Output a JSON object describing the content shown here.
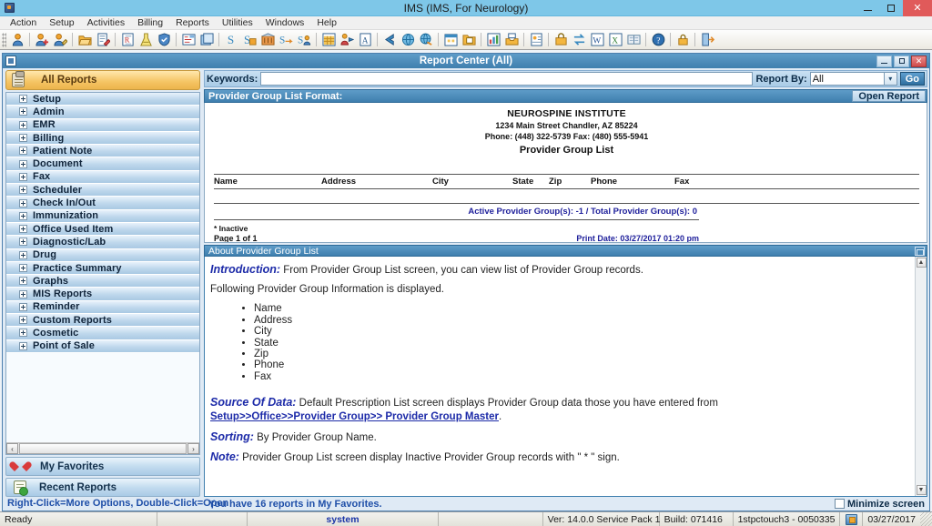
{
  "window": {
    "title": "IMS (IMS, For Neurology)",
    "controls": {
      "minimize": "–",
      "maximize": "❐",
      "close": "✕"
    }
  },
  "menubar": {
    "items": [
      "Action",
      "Setup",
      "Activities",
      "Billing",
      "Reports",
      "Utilities",
      "Windows",
      "Help"
    ]
  },
  "toolbar": {
    "groups": [
      [
        "patient-icon"
      ],
      [
        "patient-add-icon",
        "patient-edit-icon"
      ],
      [
        "open-folder-icon",
        "note-edit-icon"
      ],
      [
        "prescription-icon",
        "lab-flask-icon",
        "shield-icon"
      ],
      [
        "transcription-icon",
        "document-stack-icon"
      ],
      [
        "payment-icon",
        "charge-icon",
        "bank-icon",
        "refund-icon",
        "patient-payment-icon"
      ],
      [
        "schedule-grid-icon",
        "appointment-icon",
        "authorization-icon"
      ],
      [
        "back-arrow-icon",
        "globe-icon",
        "globe-secure-icon"
      ],
      [
        "calendar-icon",
        "folder-report-icon"
      ],
      [
        "chart-icon",
        "inbox-icon"
      ],
      [
        "contacts-icon"
      ],
      [
        "lock-money-icon",
        "exchange-icon",
        "word-export-icon",
        "excel-export-icon",
        "book-icon"
      ],
      [
        "help-icon"
      ],
      [
        "security-lock-icon"
      ],
      [
        "exit-icon"
      ]
    ]
  },
  "report_center": {
    "title": "Report Center (All)",
    "controls": {
      "minimize": "–",
      "restore": "❐",
      "close": "✕"
    },
    "search": {
      "keywords_label": "Keywords:",
      "keywords_value": "",
      "report_by_label": "Report By:",
      "report_by_value": "All",
      "go_label": "Go"
    },
    "format_bar": {
      "label": "Provider Group List Format:",
      "open_report_label": "Open Report"
    }
  },
  "sidebar": {
    "header": "All Reports",
    "items": [
      {
        "label": "Setup"
      },
      {
        "label": "Admin"
      },
      {
        "label": "EMR"
      },
      {
        "label": "Billing"
      },
      {
        "label": "Patient Note"
      },
      {
        "label": "Document"
      },
      {
        "label": "Fax"
      },
      {
        "label": "Scheduler"
      },
      {
        "label": "Check In/Out"
      },
      {
        "label": "Immunization"
      },
      {
        "label": "Office Used Item"
      },
      {
        "label": "Diagnostic/Lab"
      },
      {
        "label": "Drug"
      },
      {
        "label": "Practice Summary"
      },
      {
        "label": "Graphs"
      },
      {
        "label": "MIS Reports"
      },
      {
        "label": "Reminder"
      },
      {
        "label": "Custom Reports"
      },
      {
        "label": "Cosmetic"
      },
      {
        "label": "Point of Sale"
      }
    ],
    "favorites_label": "My Favorites",
    "recent_label": "Recent Reports",
    "hint": "Right-Click=More Options, Double-Click=Open",
    "scroll_left": "‹",
    "scroll_right": "›"
  },
  "preview": {
    "org_name": "NEUROSPINE INSTITUTE",
    "address_line": "1234 Main Street    Chandler, AZ 85224",
    "phone_line": "Phone: (448) 322-5739  Fax: (480) 555-5941",
    "report_title": "Provider Group List",
    "columns": [
      "Name",
      "Address",
      "City",
      "State",
      "Zip",
      "Phone",
      "Fax"
    ],
    "rows": [],
    "totals_line": "Active Provider Group(s): -1 / Total Provider Group(s): 0",
    "inactive_note": "* Inactive",
    "page_line": "Page 1 of 1",
    "print_date": "Print Date: 03/27/2017 01:20 pm"
  },
  "about": {
    "header": "About Provider Group List",
    "intro_label": "Introduction:",
    "intro_text": "From Provider Group List screen, you can view list of Provider Group records.",
    "following_text": "Following Provider Group Information is displayed.",
    "fields": [
      "Name",
      "Address",
      "City",
      "State",
      "Zip",
      "Phone",
      "Fax"
    ],
    "source_label": "Source Of Data:",
    "source_text": "Default Prescription List screen displays Provider Group data those you have entered from",
    "source_link": "Setup>>Office>>Provider Group>> Provider Group Master",
    "source_link_suffix": ".",
    "sorting_label": "Sorting:",
    "sorting_text": "By Provider Group Name.",
    "note_label": "Note:",
    "note_text": "Provider Group List screen display Inactive Provider Group records with \" * \" sign.",
    "scroll_up": "▲",
    "scroll_down": "▼"
  },
  "bottom": {
    "favorites_message": "You have 16 reports in My Favorites.",
    "minimize_screen_label": "Minimize screen"
  },
  "statusbar": {
    "ready": "Ready",
    "blank1": "",
    "system": "system",
    "blank2": "",
    "version": "Ver: 14.0.0 Service Pack 1",
    "build": "Build: 071416",
    "machine": "1stpctouch3 - 0050335",
    "date": "03/27/2017"
  },
  "colors": {
    "os_titlebar": "#7ec7e8",
    "mdi_titlebar": "#3f7fae",
    "accent_gold": "#f5c463",
    "link": "#1c2aa8",
    "close_red": "#e05a5a"
  }
}
